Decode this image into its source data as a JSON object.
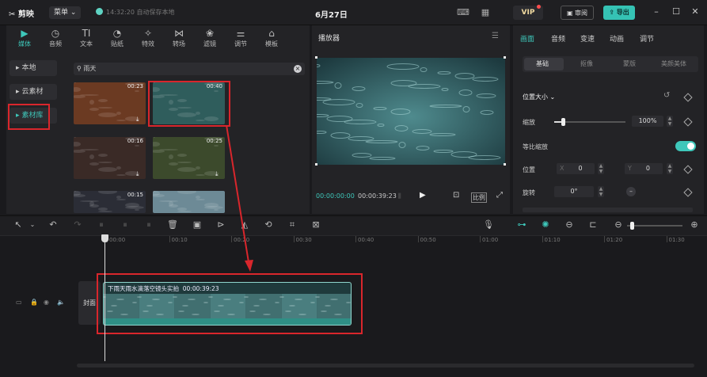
{
  "topbar": {
    "logo": "剪映",
    "menu_label": "菜单",
    "save_status": "14:32:20 自动保存本地",
    "project_title": "6月27日",
    "vip_label": "VIP",
    "review_label": "审阅",
    "export_label": "导出"
  },
  "media_tabs": [
    {
      "label": "媒体",
      "icon": "▶"
    },
    {
      "label": "音频",
      "icon": "◷"
    },
    {
      "label": "文本",
      "icon": "TI"
    },
    {
      "label": "贴纸",
      "icon": "◔"
    },
    {
      "label": "特效",
      "icon": "✧"
    },
    {
      "label": "转场",
      "icon": "⋈"
    },
    {
      "label": "滤镜",
      "icon": "❀"
    },
    {
      "label": "调节",
      "icon": "⚌"
    },
    {
      "label": "模板",
      "icon": "⌂"
    }
  ],
  "left_nav": [
    {
      "label": "本地"
    },
    {
      "label": "云素材"
    },
    {
      "label": "素材库"
    }
  ],
  "search": {
    "value": "雨天"
  },
  "thumbnails": [
    {
      "duration": "00:23",
      "icon": "download-icon",
      "color": "#6b3a22"
    },
    {
      "duration": "00:40",
      "icon": "",
      "color": "#2f5d5c"
    },
    {
      "duration": "00:16",
      "icon": "download-icon",
      "color": "#3a2a26"
    },
    {
      "duration": "00:25",
      "icon": "download-icon",
      "color": "#3c4a2c"
    },
    {
      "duration": "00:15",
      "icon": "",
      "color": "#2b2d36"
    },
    {
      "duration": "",
      "icon": "",
      "color": "#6d8a96"
    }
  ],
  "player": {
    "title": "播放器",
    "current_time": "00:00:00:00",
    "total_time": "00:00:39:23",
    "ratio_label": "比例"
  },
  "props": {
    "tabs": [
      "画面",
      "音频",
      "变速",
      "动画",
      "调节"
    ],
    "subtabs": [
      "基础",
      "抠像",
      "蒙版",
      "美颜美体"
    ],
    "section_title": "位置大小",
    "scale_label": "缩放",
    "scale_value": "100%",
    "scale_level": 0.12,
    "uniform_label": "等比缩放",
    "position_label": "位置",
    "pos_x_label": "X",
    "pos_x": "0",
    "pos_y_label": "Y",
    "pos_y": "0",
    "rotate_label": "旋转",
    "rotate_value": "0°"
  },
  "timeline": {
    "ruler": [
      "00:00",
      "00:10",
      "00:20",
      "00:30",
      "00:40",
      "00:50",
      "01:00",
      "01:10",
      "01:20",
      "01:30"
    ],
    "cover_label": "封面",
    "clip_name": "下雨天雨水滴落空镜头实拍",
    "clip_duration": "00:00:39:23"
  },
  "colors": {
    "accent": "#3ec7ba",
    "highlight": "#d9262c"
  }
}
